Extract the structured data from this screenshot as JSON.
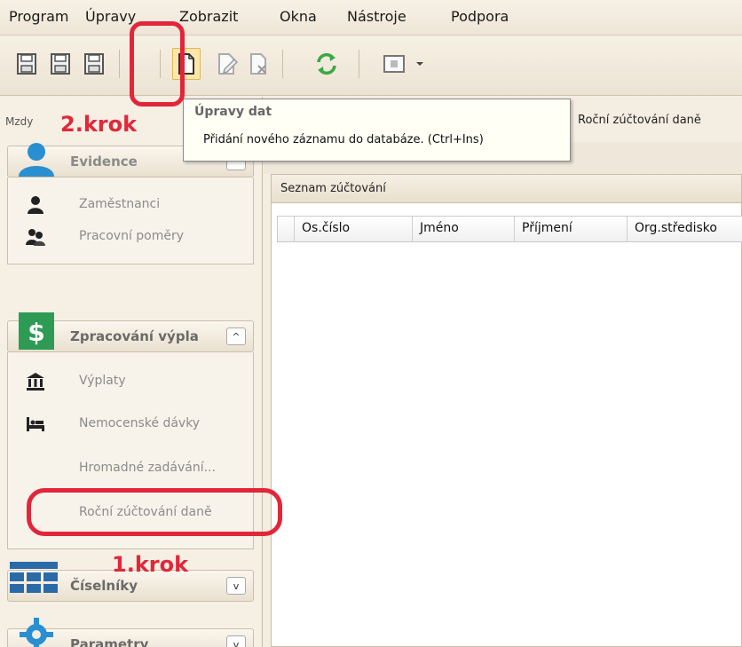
{
  "menu": [
    "Program",
    "Úpravy",
    "Zobrazit",
    "Okna",
    "Nástroje",
    "Podpora"
  ],
  "toolbar": {
    "buttons": [
      "save-icon",
      "save-all-icon",
      "save-as-icon",
      "new-record-icon",
      "edit-record-icon",
      "delete-record-icon",
      "refresh-icon",
      "view-icon",
      "dropdown-arrow-icon"
    ]
  },
  "breadcrumb": "Mzdy",
  "breadcrumb_right": "Roční zúčtování daně",
  "tooltip": {
    "title": "Úpravy dat",
    "text": "Přidání nového záznamu do databáze. (Ctrl+Ins)"
  },
  "sidebar": {
    "groups": [
      {
        "title": "Evidence",
        "toggle": "^",
        "items": [
          "Zaměstnanci",
          "Pracovní poměry"
        ]
      },
      {
        "title": "Zpracování výpla",
        "toggle": "^",
        "items": [
          "Výplaty",
          "Nemocenské dávky",
          "Hromadné zadávání...",
          "Roční zúčtování daně"
        ]
      },
      {
        "title": "Číselníky",
        "toggle": "v",
        "items": []
      },
      {
        "title": "Parametry",
        "toggle": "v",
        "items": []
      }
    ]
  },
  "main": {
    "panel_title": "Seznam zúčtování",
    "columns": [
      "Os.číslo",
      "Jméno",
      "Příjmení",
      "Org.středisko"
    ]
  },
  "annotations": {
    "step1": "1.krok",
    "step2": "2.krok"
  },
  "colors": {
    "annotation": "#e3253a",
    "evidence_icon": "#2a8fd0",
    "zpracovani_icon": "#2e9b55",
    "ciselniky_icon": "#2b6aa8",
    "parametry_icon": "#2a8fd0"
  }
}
